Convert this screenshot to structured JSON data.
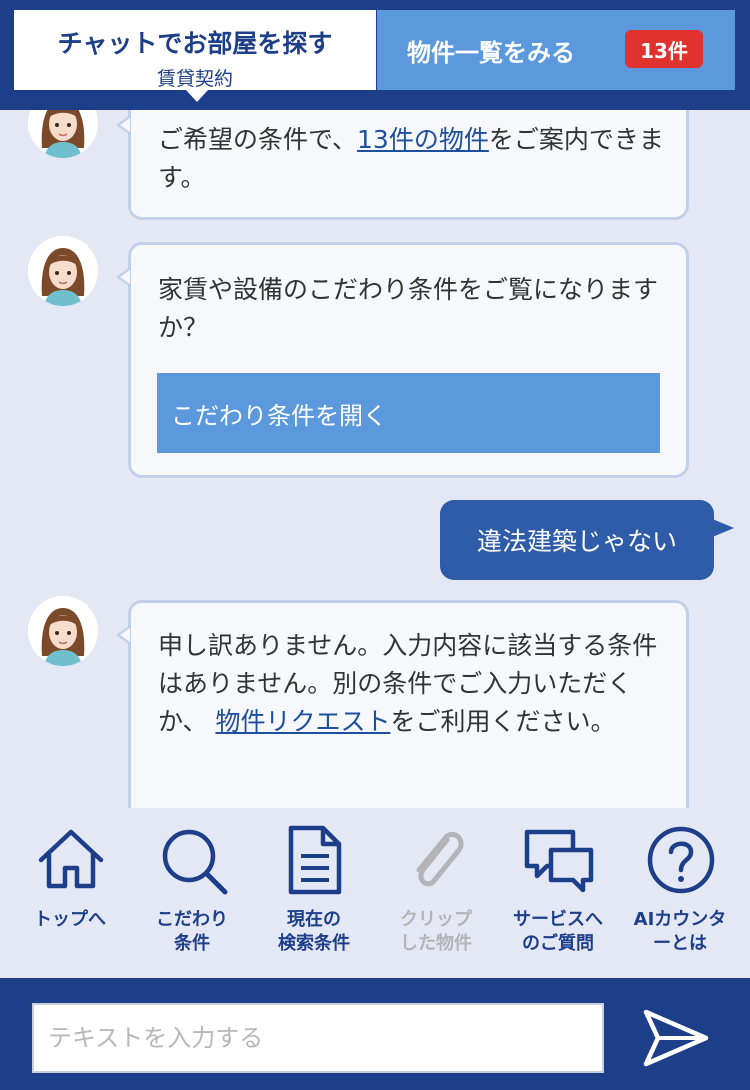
{
  "header": {
    "title": "チャットでお部屋を探す",
    "subtitle": "賃貸契約",
    "list_button_label": "物件一覧をみる",
    "count_badge": "13件"
  },
  "messages": {
    "m1": {
      "before": "ご希望の条件で、",
      "link": "13件の物件",
      "after": "をご案内できます。"
    },
    "m2": {
      "text": "家賃や設備のこだわり条件をご覧になりますか？",
      "button_label": "こだわり条件を開く"
    },
    "user": {
      "text": "違法建築じゃない"
    },
    "m3": {
      "before": "申し訳ありません。入力内容に該当する条件はありません。別の条件でご入力いただくか、 ",
      "link": "物件リクエスト",
      "after": "をご利用ください。"
    }
  },
  "nav": {
    "items": [
      {
        "line1": "トップへ",
        "line2": "",
        "icon": "home-icon"
      },
      {
        "line1": "こだわり",
        "line2": "条件",
        "icon": "search-icon"
      },
      {
        "line1": "現在の",
        "line2": "検索条件",
        "icon": "document-icon"
      },
      {
        "line1": "クリップ",
        "line2": "した物件",
        "icon": "paperclip-icon"
      },
      {
        "line1": "サービスへ",
        "line2": "のご質問",
        "icon": "chat-bubbles-icon"
      },
      {
        "line1": "AIカウンタ",
        "line2": "ーとは",
        "icon": "question-icon"
      }
    ]
  },
  "input": {
    "placeholder": "テキストを入力する"
  },
  "colors": {
    "brand_navy": "#1d3f8a",
    "accent_blue": "#5b99dc",
    "user_bubble": "#2e5ca8",
    "badge_red": "#e0322e",
    "disabled_gray": "#b4b4b8"
  }
}
